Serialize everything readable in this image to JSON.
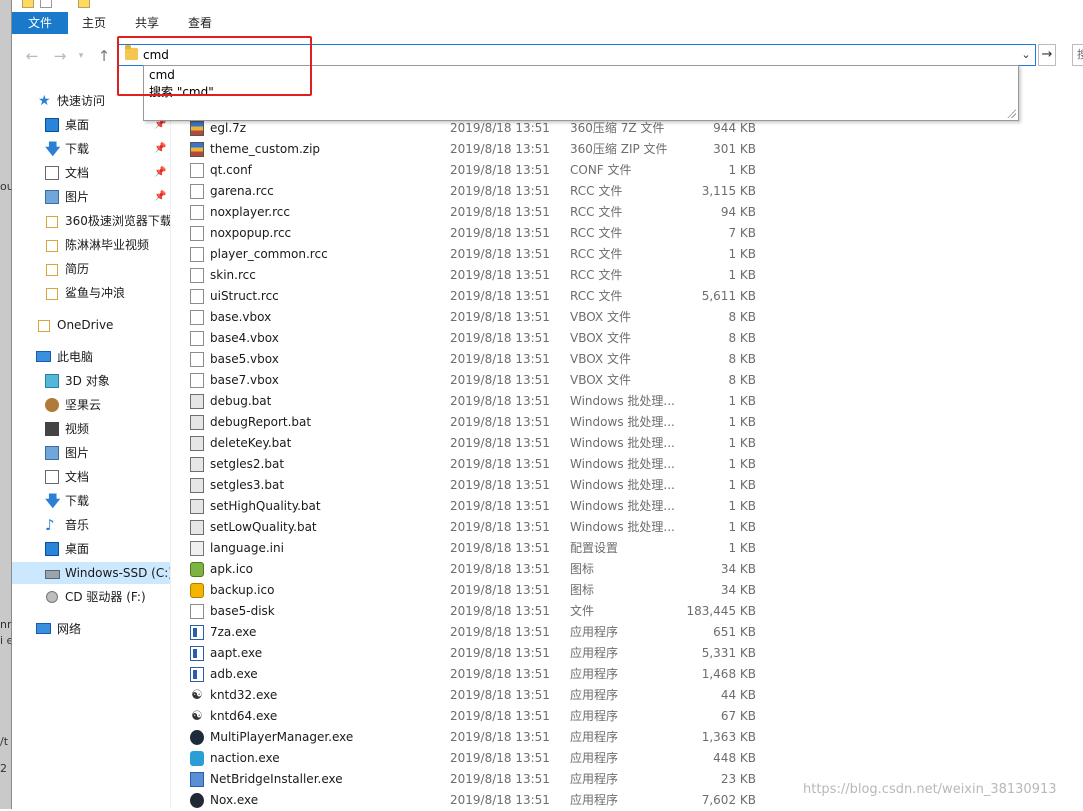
{
  "desktop_fragments": [
    "ou",
    "nn",
    "i e",
    "/t",
    "2"
  ],
  "ribbon": {
    "tabs": [
      {
        "label": "文件"
      },
      {
        "label": "主页"
      },
      {
        "label": "共享"
      },
      {
        "label": "查看"
      }
    ]
  },
  "address_bar": {
    "value": "cmd",
    "search_placeholder": "搜"
  },
  "autocomplete": {
    "items": [
      "cmd",
      "搜索 \"cmd\""
    ]
  },
  "sidebar": {
    "quick_access": "快速访问",
    "quick_items": [
      {
        "label": "桌面",
        "icon": "desktop-icon"
      },
      {
        "label": "下载",
        "icon": "download-icon"
      },
      {
        "label": "文档",
        "icon": "document-icon"
      },
      {
        "label": "图片",
        "icon": "picture-icon"
      },
      {
        "label": "360极速浏览器下载",
        "icon": "folder-icon"
      },
      {
        "label": "陈淋淋毕业视频",
        "icon": "folder-icon"
      },
      {
        "label": "简历",
        "icon": "folder-icon"
      },
      {
        "label": "鲨鱼与冲浪",
        "icon": "folder-icon"
      }
    ],
    "onedrive": "OneDrive",
    "this_pc": "此电脑",
    "pc_items": [
      {
        "label": "3D 对象",
        "icon": "3d-objects-icon"
      },
      {
        "label": "坚果云",
        "icon": "nutstore-icon"
      },
      {
        "label": "视频",
        "icon": "video-icon"
      },
      {
        "label": "图片",
        "icon": "picture-icon"
      },
      {
        "label": "文档",
        "icon": "document-icon"
      },
      {
        "label": "下载",
        "icon": "download-icon"
      },
      {
        "label": "音乐",
        "icon": "music-icon"
      },
      {
        "label": "桌面",
        "icon": "desktop-icon"
      },
      {
        "label": "Windows-SSD (C:)",
        "icon": "drive-icon"
      },
      {
        "label": "CD 驱动器 (F:)",
        "icon": "cd-drive-icon"
      }
    ],
    "network": "网络"
  },
  "files": [
    {
      "name": "egl.7z",
      "date": "2019/8/18 13:51",
      "type": "360压缩 7Z 文件",
      "size": "944 KB",
      "icon": "zip-icon"
    },
    {
      "name": "theme_custom.zip",
      "date": "2019/8/18 13:51",
      "type": "360压缩 ZIP 文件",
      "size": "301 KB",
      "icon": "zip-icon"
    },
    {
      "name": "qt.conf",
      "date": "2019/8/18 13:51",
      "type": "CONF 文件",
      "size": "1 KB",
      "icon": "file-icon"
    },
    {
      "name": "garena.rcc",
      "date": "2019/8/18 13:51",
      "type": "RCC 文件",
      "size": "3,115 KB",
      "icon": "file-icon"
    },
    {
      "name": "noxplayer.rcc",
      "date": "2019/8/18 13:51",
      "type": "RCC 文件",
      "size": "94 KB",
      "icon": "file-icon"
    },
    {
      "name": "noxpopup.rcc",
      "date": "2019/8/18 13:51",
      "type": "RCC 文件",
      "size": "7 KB",
      "icon": "file-icon"
    },
    {
      "name": "player_common.rcc",
      "date": "2019/8/18 13:51",
      "type": "RCC 文件",
      "size": "1 KB",
      "icon": "file-icon"
    },
    {
      "name": "skin.rcc",
      "date": "2019/8/18 13:51",
      "type": "RCC 文件",
      "size": "1 KB",
      "icon": "file-icon"
    },
    {
      "name": "uiStruct.rcc",
      "date": "2019/8/18 13:51",
      "type": "RCC 文件",
      "size": "5,611 KB",
      "icon": "file-icon"
    },
    {
      "name": "base.vbox",
      "date": "2019/8/18 13:51",
      "type": "VBOX 文件",
      "size": "8 KB",
      "icon": "file-icon"
    },
    {
      "name": "base4.vbox",
      "date": "2019/8/18 13:51",
      "type": "VBOX 文件",
      "size": "8 KB",
      "icon": "file-icon"
    },
    {
      "name": "base5.vbox",
      "date": "2019/8/18 13:51",
      "type": "VBOX 文件",
      "size": "8 KB",
      "icon": "file-icon"
    },
    {
      "name": "base7.vbox",
      "date": "2019/8/18 13:51",
      "type": "VBOX 文件",
      "size": "8 KB",
      "icon": "file-icon"
    },
    {
      "name": "debug.bat",
      "date": "2019/8/18 13:51",
      "type": "Windows 批处理...",
      "size": "1 KB",
      "icon": "batch-file-icon"
    },
    {
      "name": "debugReport.bat",
      "date": "2019/8/18 13:51",
      "type": "Windows 批处理...",
      "size": "1 KB",
      "icon": "batch-file-icon"
    },
    {
      "name": "deleteKey.bat",
      "date": "2019/8/18 13:51",
      "type": "Windows 批处理...",
      "size": "1 KB",
      "icon": "batch-file-icon"
    },
    {
      "name": "setgles2.bat",
      "date": "2019/8/18 13:51",
      "type": "Windows 批处理...",
      "size": "1 KB",
      "icon": "batch-file-icon"
    },
    {
      "name": "setgles3.bat",
      "date": "2019/8/18 13:51",
      "type": "Windows 批处理...",
      "size": "1 KB",
      "icon": "batch-file-icon"
    },
    {
      "name": "setHighQuality.bat",
      "date": "2019/8/18 13:51",
      "type": "Windows 批处理...",
      "size": "1 KB",
      "icon": "batch-file-icon"
    },
    {
      "name": "setLowQuality.bat",
      "date": "2019/8/18 13:51",
      "type": "Windows 批处理...",
      "size": "1 KB",
      "icon": "batch-file-icon"
    },
    {
      "name": "language.ini",
      "date": "2019/8/18 13:51",
      "type": "配置设置",
      "size": "1 KB",
      "icon": "settings-file-icon"
    },
    {
      "name": "apk.ico",
      "date": "2019/8/18 13:51",
      "type": "图标",
      "size": "34 KB",
      "icon": "apk-icon"
    },
    {
      "name": "backup.ico",
      "date": "2019/8/18 13:51",
      "type": "图标",
      "size": "34 KB",
      "icon": "backup-icon"
    },
    {
      "name": "base5-disk",
      "date": "2019/8/18 13:51",
      "type": "文件",
      "size": "183,445 KB",
      "icon": "file-icon"
    },
    {
      "name": "7za.exe",
      "date": "2019/8/18 13:51",
      "type": "应用程序",
      "size": "651 KB",
      "icon": "exe-icon"
    },
    {
      "name": "aapt.exe",
      "date": "2019/8/18 13:51",
      "type": "应用程序",
      "size": "5,331 KB",
      "icon": "exe-icon"
    },
    {
      "name": "adb.exe",
      "date": "2019/8/18 13:51",
      "type": "应用程序",
      "size": "1,468 KB",
      "icon": "exe-icon"
    },
    {
      "name": "kntd32.exe",
      "date": "2019/8/18 13:51",
      "type": "应用程序",
      "size": "44 KB",
      "icon": "kntd-icon"
    },
    {
      "name": "kntd64.exe",
      "date": "2019/8/18 13:51",
      "type": "应用程序",
      "size": "67 KB",
      "icon": "kntd-icon"
    },
    {
      "name": "MultiPlayerManager.exe",
      "date": "2019/8/18 13:51",
      "type": "应用程序",
      "size": "1,363 KB",
      "icon": "multiplayer-icon"
    },
    {
      "name": "naction.exe",
      "date": "2019/8/18 13:51",
      "type": "应用程序",
      "size": "448 KB",
      "icon": "naction-icon"
    },
    {
      "name": "NetBridgeInstaller.exe",
      "date": "2019/8/18 13:51",
      "type": "应用程序",
      "size": "23 KB",
      "icon": "netbridge-icon"
    },
    {
      "name": "Nox.exe",
      "date": "2019/8/18 13:51",
      "type": "应用程序",
      "size": "7,602 KB",
      "icon": "nox-icon"
    }
  ],
  "watermark": "https://blog.csdn.net/weixin_38130913"
}
